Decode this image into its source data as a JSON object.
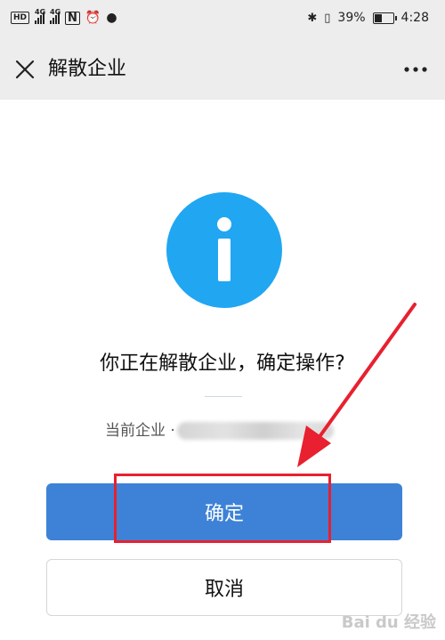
{
  "status_bar": {
    "hd_label": "HD",
    "network_1": "4G",
    "network_2": "4G",
    "battery_percent": "39%",
    "time": "4:28",
    "icons": [
      "hd-icon",
      "signal-icon",
      "signal-icon",
      "nfc-icon",
      "alarm-icon",
      "wechat-icon",
      "bluetooth-icon",
      "vibrate-icon",
      "battery-icon"
    ]
  },
  "header": {
    "title": "解散企业",
    "close_icon": "close-icon",
    "more_icon": "more-icon"
  },
  "dialog": {
    "icon": "info-icon",
    "question": "你正在解散企业，确定操作?",
    "company_label": "当前企业 ·",
    "company_name_blurred": true,
    "confirm_label": "确定",
    "cancel_label": "取消"
  },
  "annotation": {
    "highlight_color": "#e8202f",
    "arrow_color": "#e8202f"
  },
  "colors": {
    "accent": "#3d82d6",
    "info_circle": "#21a6f2",
    "bar_bg": "#ededed"
  },
  "watermark": "Bai du 经验"
}
